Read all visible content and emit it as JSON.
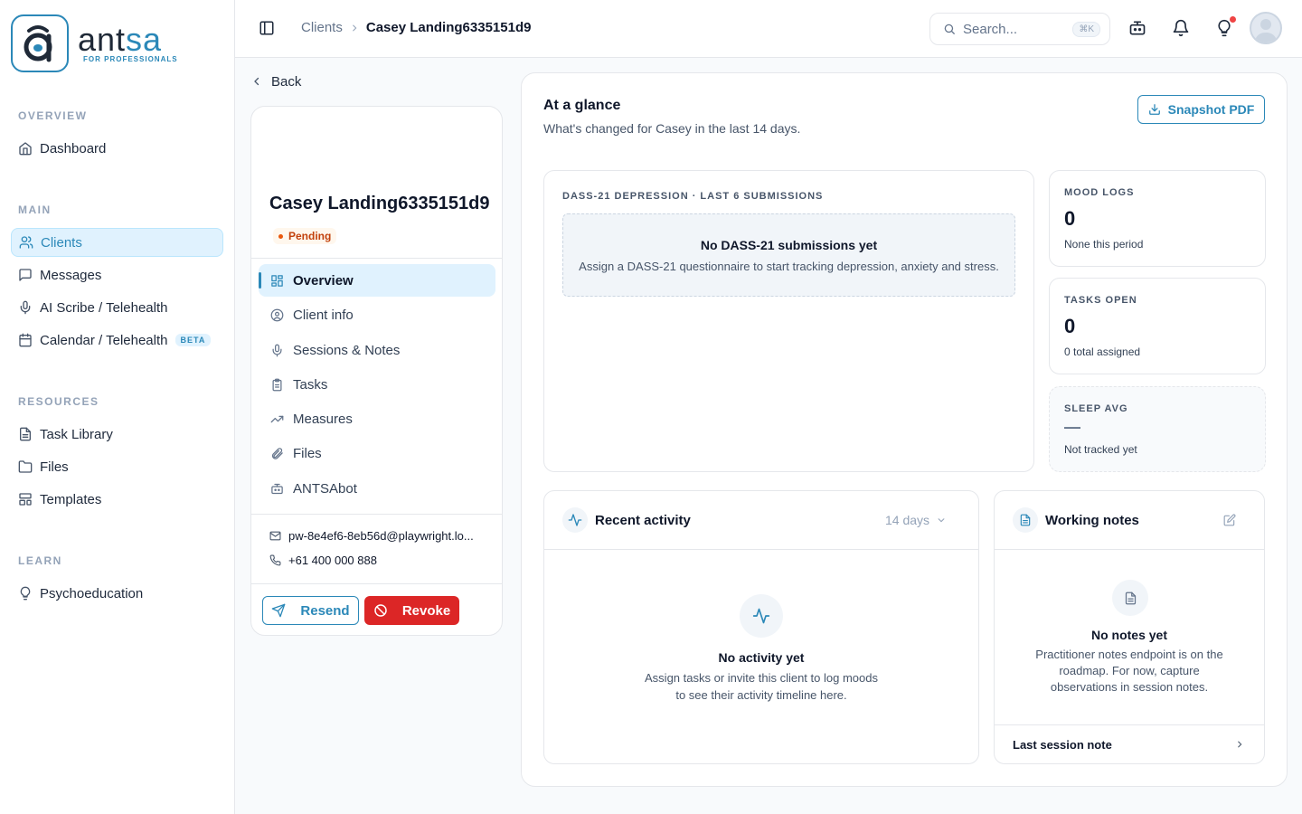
{
  "brand": {
    "name_dark": "ant",
    "name_accent": "sa",
    "tagline": "FOR PROFESSIONALS",
    "accent_color": "#2b88b8"
  },
  "sidebar": {
    "sections": {
      "overview": "OVERVIEW",
      "main": "MAIN",
      "resources": "RESOURCES",
      "learn": "LEARN"
    },
    "items": {
      "dashboard": "Dashboard",
      "clients": "Clients",
      "messages": "Messages",
      "ai_scribe": "AI Scribe / Telehealth",
      "calendar": "Calendar / Telehealth",
      "calendar_badge": "BETA",
      "task_library": "Task Library",
      "files": "Files",
      "templates": "Templates",
      "psychoeducation": "Psychoeducation"
    },
    "active_item": "clients"
  },
  "topbar": {
    "breadcrumb_parent": "Clients",
    "breadcrumb_current": "Casey Landing6335151d9",
    "search_placeholder": "Search...",
    "search_shortcut": "⌘K",
    "icons": [
      "panel-toggle-icon",
      "bot-icon",
      "bell-icon",
      "lightbulb-icon"
    ]
  },
  "client": {
    "back_label": "Back",
    "name": "Casey Landing6335151d9",
    "status": "Pending",
    "status_color": "#c2410c",
    "nav": {
      "overview": "Overview",
      "client_info": "Client info",
      "sessions": "Sessions & Notes",
      "tasks": "Tasks",
      "measures": "Measures",
      "files": "Files",
      "antsabot": "ANTSAbot"
    },
    "email": "pw-8e4ef6-8eb56d@playwright.lo...",
    "phone": "+61 400 000 888",
    "resend_label": "Resend",
    "revoke_label": "Revoke",
    "revoke_color": "#dc2626"
  },
  "glance": {
    "title": "At a glance",
    "subtitle": "What's changed for Casey in the last 14 days.",
    "pdf_label": "Snapshot PDF",
    "dass": {
      "label": "DASS-21 DEPRESSION · LAST 6 SUBMISSIONS",
      "empty_title": "No DASS-21 submissions yet",
      "empty_desc": "Assign a DASS-21 questionnaire to start tracking depression, anxiety and stress."
    },
    "mood": {
      "label": "MOOD LOGS",
      "value": "0",
      "note": "None this period"
    },
    "tasks": {
      "label": "TASKS OPEN",
      "value": "0",
      "note": "0 total assigned"
    },
    "sleep": {
      "label": "SLEEP AVG",
      "value": "—",
      "note": "Not tracked yet"
    }
  },
  "activity": {
    "title": "Recent activity",
    "range": "14 days",
    "empty_title": "No activity yet",
    "empty_desc_line1": "Assign tasks or invite this client to log moods",
    "empty_desc_line2": "to see their activity timeline here."
  },
  "notes": {
    "title": "Working notes",
    "empty_title": "No notes yet",
    "empty_desc_line1": "Practitioner notes endpoint is on the",
    "empty_desc_line2": "roadmap. For now, capture",
    "empty_desc_line3": "observations in session notes.",
    "last_session_label": "Last session note"
  }
}
